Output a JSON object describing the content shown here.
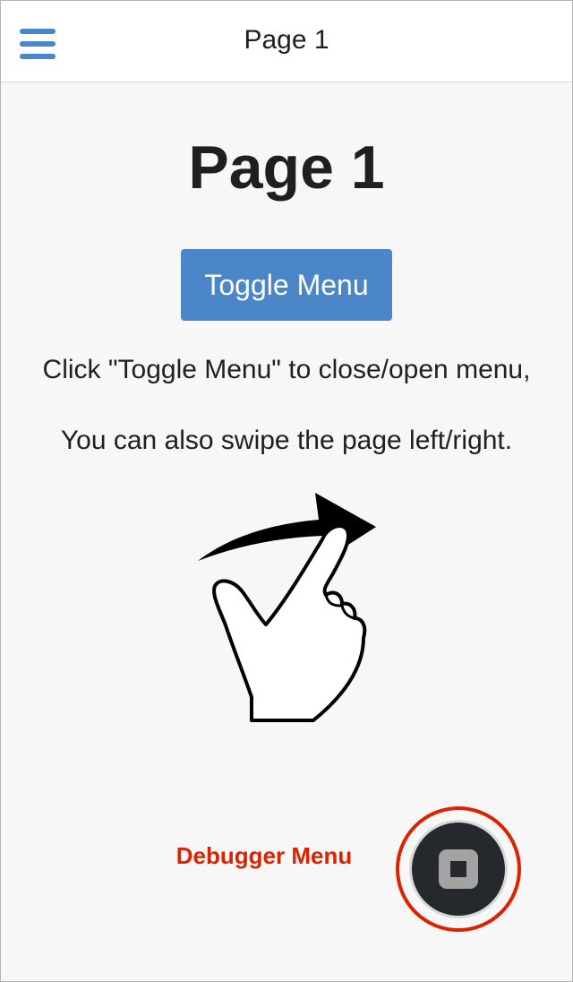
{
  "navbar": {
    "title": "Page 1",
    "menu_icon": "hamburger-menu-icon",
    "accent_color": "#4a86c8"
  },
  "main": {
    "heading": "Page 1",
    "toggle_button_label": "Toggle Menu",
    "instruction_line_1": "Click \"Toggle Menu\" to close/open menu,",
    "instruction_line_2": "You can also swipe the page left/right.",
    "gesture_icon": "swipe-gesture-icon"
  },
  "debugger": {
    "label": "Debugger Menu",
    "label_color": "#dd2200",
    "button_icon": "stop-square-icon"
  }
}
